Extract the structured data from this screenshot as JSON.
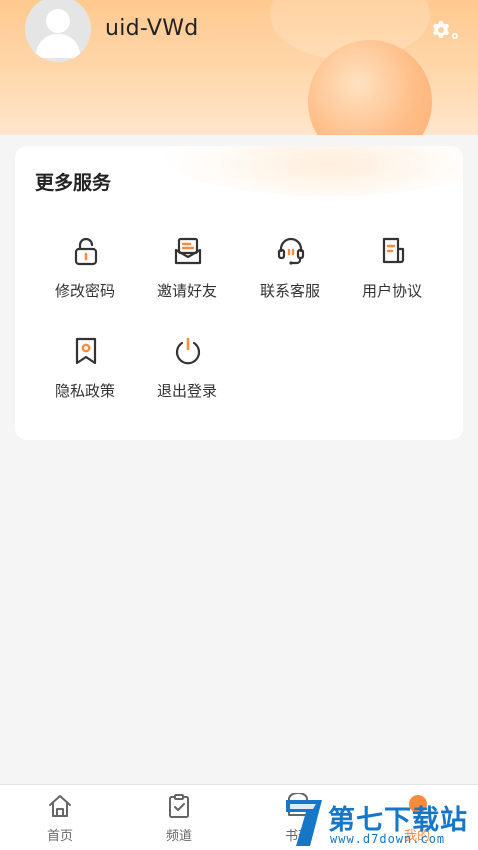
{
  "profile": {
    "username": "uid-VWd"
  },
  "icons": {
    "settings": "gear-icon",
    "avatar": "default-avatar"
  },
  "colors": {
    "accent": "#ff8a3c",
    "header_start": "#ffc98f",
    "header_end": "#ffe6cc",
    "icon_stroke": "#333333",
    "watermark": "#1677c8"
  },
  "services": {
    "title": "更多服务",
    "items": [
      {
        "label": "修改密码",
        "icon": "lock-icon"
      },
      {
        "label": "邀请好友",
        "icon": "invite-mail-icon"
      },
      {
        "label": "联系客服",
        "icon": "headset-icon"
      },
      {
        "label": "用户协议",
        "icon": "document-icon"
      },
      {
        "label": "隐私政策",
        "icon": "privacy-bookmark-icon"
      },
      {
        "label": "退出登录",
        "icon": "power-icon"
      }
    ]
  },
  "nav": {
    "items": [
      {
        "label": "首页",
        "icon": "home-icon"
      },
      {
        "label": "频道",
        "icon": "clipboard-check-icon"
      },
      {
        "label": "书架",
        "icon": "bookshelf-icon"
      },
      {
        "label": "我的",
        "icon": "profile-icon",
        "active": true
      }
    ]
  },
  "watermark": {
    "text": "第七下载站",
    "url": "www.d7down.com"
  }
}
